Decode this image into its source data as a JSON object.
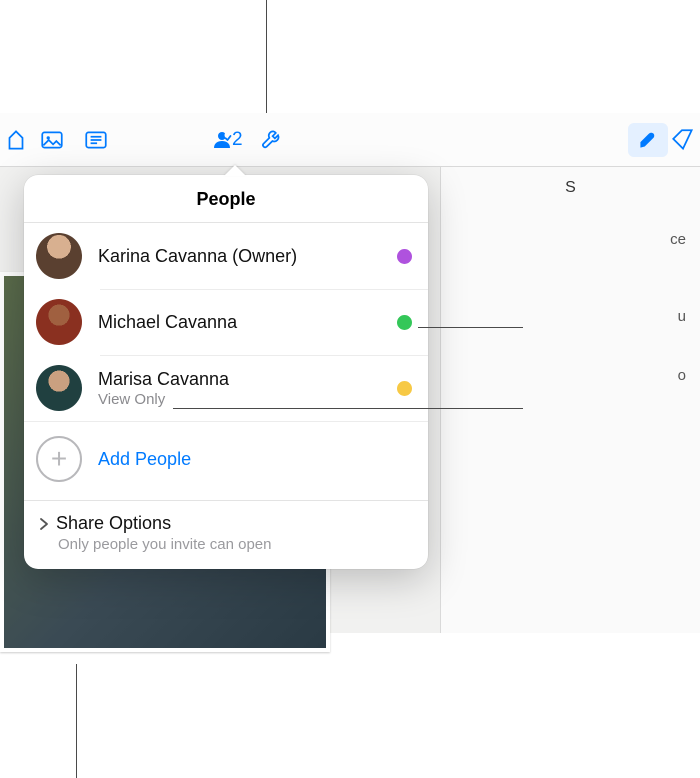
{
  "toolbar": {
    "collab_count": "2",
    "icons": {
      "insert": "insert-icon",
      "image": "image-icon",
      "text": "text-icon",
      "collaborate": "collaborate-icon",
      "tools": "tools-icon",
      "format": "format-brush-icon",
      "tag": "tag-icon"
    }
  },
  "inspector": {
    "header_hint": "S",
    "row1_hint": "ce",
    "row2_hint": "u",
    "row3_hint": "o"
  },
  "popover": {
    "title": "People",
    "people": [
      {
        "name": "Karina Cavanna (Owner)",
        "sub": "",
        "dot": "purple"
      },
      {
        "name": "Michael Cavanna",
        "sub": "",
        "dot": "green"
      },
      {
        "name": "Marisa Cavanna",
        "sub": "View Only",
        "dot": "yellow"
      }
    ],
    "add_label": "Add People",
    "share": {
      "label": "Share Options",
      "sub": "Only people you invite can open"
    }
  }
}
